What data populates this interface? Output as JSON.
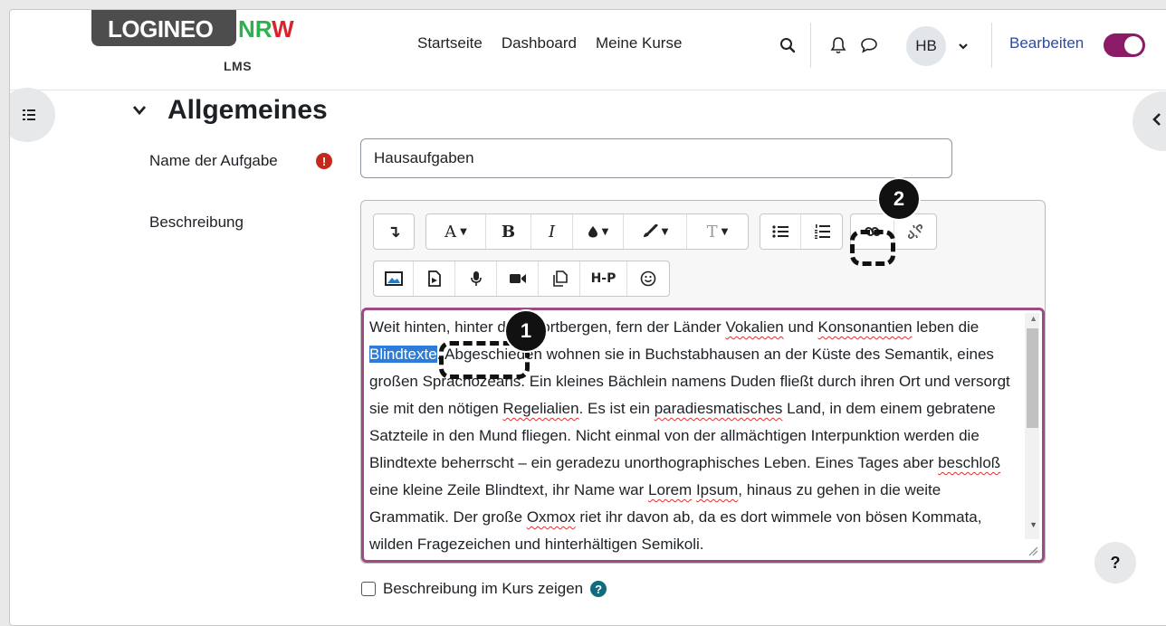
{
  "brand": {
    "logo_main": "LOGINEO",
    "logo_nr": "NR",
    "logo_w": "W",
    "logo_sub": "LMS"
  },
  "nav": {
    "items": [
      "Startseite",
      "Dashboard",
      "Meine Kurse"
    ]
  },
  "header": {
    "avatar_initials": "HB",
    "edit_label": "Bearbeiten",
    "edit_mode": true
  },
  "section": {
    "title": "Allgemeines"
  },
  "form": {
    "name_label": "Name der Aufgabe",
    "name_value": "Hausaufgaben",
    "description_label": "Beschreibung",
    "show_description_label": "Beschreibung im Kurs zeigen",
    "show_description_checked": false
  },
  "toolbar": {
    "row1": [
      [
        "↴"
      ],
      [
        "A",
        "B",
        "I",
        "drop",
        "brush",
        "T"
      ],
      [
        "bullet-list",
        "numbered-list",
        "link",
        "unlink"
      ]
    ],
    "row2": [
      "image",
      "media",
      "record-audio",
      "record-video",
      "manage-files",
      "H-P",
      "emoji"
    ],
    "h5p_label": "H-P"
  },
  "editor": {
    "segments": [
      {
        "t": "Weit hinten, hinter den Wortbergen, fern der Länder "
      },
      {
        "t": "Vokalien",
        "sp": true
      },
      {
        "t": " und "
      },
      {
        "t": "Konsonantien",
        "sp": true
      },
      {
        "t": " leben die "
      },
      {
        "t": "Blindtexte",
        "sel": true
      },
      {
        "t": ". Abgeschieden wohnen sie in Buchstabhausen an der Küste des Semantik, eines großen Sprachozeans. Ein kleines Bächlein namens Duden fließt durch ihren Ort und versorgt sie mit den nötigen "
      },
      {
        "t": "Regelialien",
        "sp": true
      },
      {
        "t": ". Es ist ein "
      },
      {
        "t": "paradiesmatisches",
        "sp": true
      },
      {
        "t": " Land, in dem einem gebratene Satzteile in den Mund fliegen. Nicht einmal von der allmächtigen Interpunktion werden die Blindtexte beherrscht – ein geradezu unorthographisches Leben. Eines Tages aber "
      },
      {
        "t": "beschloß",
        "sp": true
      },
      {
        "t": " eine kleine Zeile Blindtext, ihr Name war "
      },
      {
        "t": "Lorem",
        "sp": true
      },
      {
        "t": " "
      },
      {
        "t": "Ipsum",
        "sp": true
      },
      {
        "t": ", hinaus zu gehen in die weite Grammatik. Der große "
      },
      {
        "t": "Oxmox",
        "sp": true
      },
      {
        "t": " riet ihr davon ab, da es dort wimmele von bösen Kommata, wilden Fragezeichen und hinterhältigen Semikoli."
      }
    ]
  },
  "annotations": {
    "badge1": "1",
    "badge2": "2"
  },
  "help": {
    "fab_label": "?",
    "inline_label": "?",
    "required_label": "!"
  },
  "colors": {
    "accent": "#8b1a67",
    "selection": "#2c7cd8",
    "required": "#c4291c",
    "editor_border": "#9e4b85"
  }
}
